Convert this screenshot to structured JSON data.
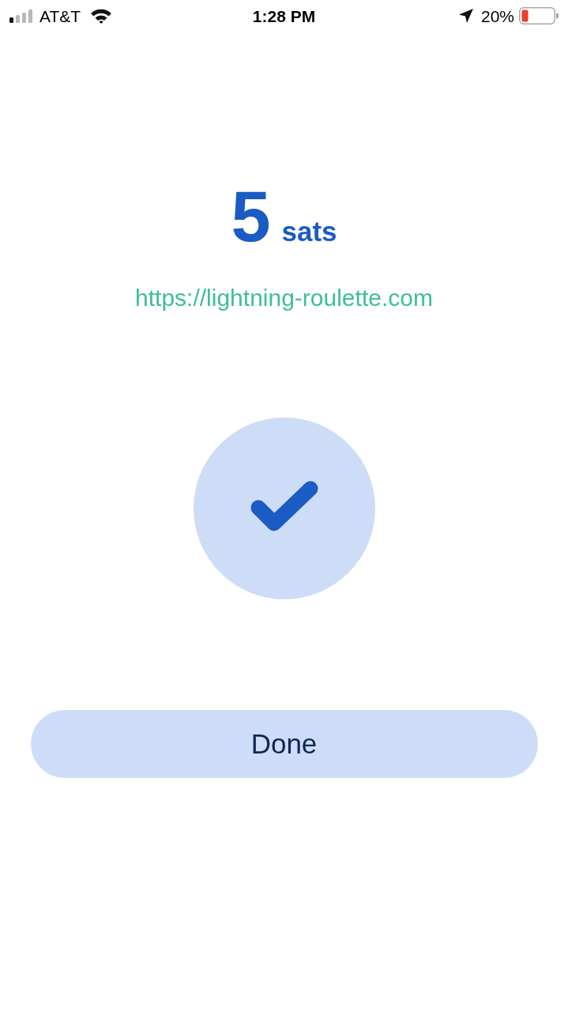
{
  "status_bar": {
    "carrier": "AT&T",
    "time": "1:28 PM",
    "battery": "20%"
  },
  "payment": {
    "amount": "5",
    "unit": "sats",
    "url": "https://lightning-roulette.com"
  },
  "done_button": {
    "label": "Done"
  }
}
